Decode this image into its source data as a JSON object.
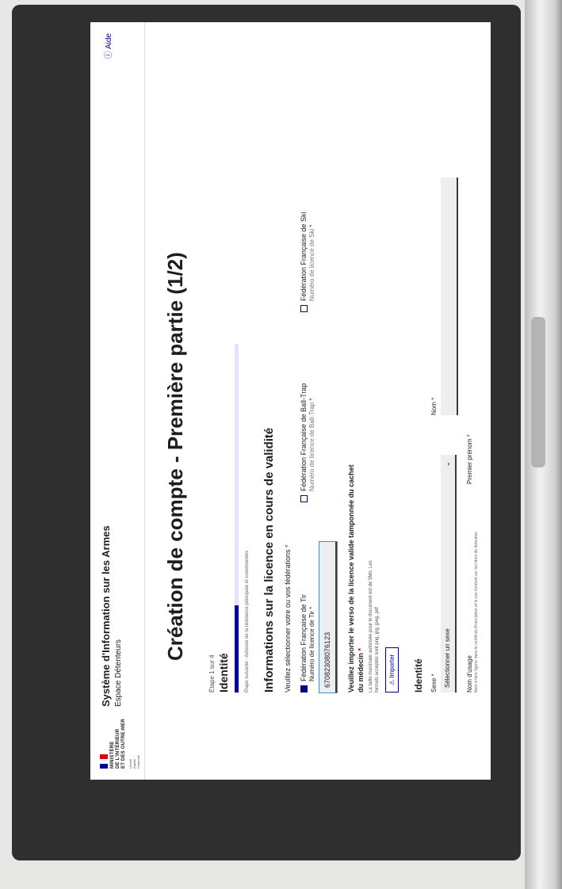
{
  "header": {
    "logo_lines": [
      "MINISTÈRE",
      "DE L'INTÉRIEUR",
      "ET DES OUTRE-MER"
    ],
    "motto_lines": [
      "Liberté",
      "Égalité",
      "Fraternité"
    ],
    "flag_colors": [
      "#000091",
      "#ffffff",
      "#e1000f"
    ],
    "site_title": "Système d'Information sur les Armes",
    "site_subtitle": "Espace Détenteurs",
    "help_icon": "help-circle-icon",
    "help_label": "Aide"
  },
  "page": {
    "title": "Création de compte - Première partie (1/2)",
    "step_indicator": "Étape 1 sur 4",
    "step_title": "Identité",
    "progress": 0.25,
    "next_step": "Étape suivante : Adresse de la résidence principale et coordonnées"
  },
  "licence": {
    "heading": "Informations sur la licence en cours de validité",
    "hint": "Veuillez sélectionner votre ou vos fédérations",
    "federations": [
      {
        "name": "Fédération Française de Tir",
        "label": "Numéro de licence de Tir",
        "checked": true,
        "value": "67082308076123"
      },
      {
        "name": "Fédération Française de Ball-Trap",
        "label": "Numéro de licence de Ball-Trap",
        "checked": false
      },
      {
        "name": "Fédération Française de Ski",
        "label": "Numéro de licence de Ski",
        "checked": false
      }
    ],
    "upload_label": "Veuillez importer le verso de la licence valide tamponnée du cachet du médecin",
    "upload_hint_1": "La taille maximale autorisée pour le document est de 5Mo. Les",
    "upload_hint_2": "formats acceptés sont png, jpg, jpeg, pdf",
    "upload_icon": "warning-icon",
    "upload_button": "Importer"
  },
  "identity": {
    "heading": "Identité",
    "sex_label": "Sexe",
    "sex_placeholder": "Sélectionner un sexe",
    "name_label": "Nom",
    "usage_name_label": "Nom d'usage",
    "usage_name_hint": "Nom à faire figurer dans le certificat d'inscription et le cas échéant sur les titres de détention",
    "first_name_label": "Premier prénom"
  },
  "colors": {
    "primary": "#000091",
    "required": "#ce0500"
  }
}
